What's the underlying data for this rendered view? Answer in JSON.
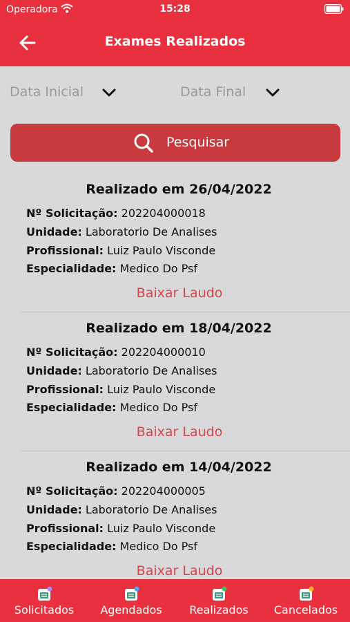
{
  "status": {
    "carrier": "Operadora",
    "time": "15:28"
  },
  "header": {
    "title": "Exames Realizados"
  },
  "filters": {
    "start_label": "Data Inicial",
    "end_label": "Data Final"
  },
  "search": {
    "label": "Pesquisar"
  },
  "exams": [
    {
      "date": "Realizado em 26/04/2022",
      "request": "202204000018",
      "unit": "Laboratorio De Analises",
      "professional": "Luiz Paulo Visconde",
      "specialty": "Medico Do Psf",
      "download": "Baixar Laudo"
    },
    {
      "date": "Realizado em 18/04/2022",
      "request": "202204000010",
      "unit": "Laboratorio De Analises",
      "professional": "Luiz Paulo Visconde",
      "specialty": "Medico Do Psf",
      "download": "Baixar Laudo"
    },
    {
      "date": "Realizado em 14/04/2022",
      "request": "202204000005",
      "unit": "Laboratorio De Analises",
      "professional": "Luiz Paulo Visconde",
      "specialty": "Medico Do Psf",
      "download": "Baixar Laudo"
    }
  ],
  "field_labels": {
    "request": "Nº Solicitação:",
    "unit": "Unidade:",
    "professional": "Profissional:",
    "specialty": "Especialidade:"
  },
  "tabs": [
    {
      "label": "Solicitados",
      "badge_color": "#a989ff"
    },
    {
      "label": "Agendados",
      "badge_color": "#4fa3ff"
    },
    {
      "label": "Realizados",
      "badge_color": "#3fbf5f"
    },
    {
      "label": "Cancelados",
      "badge_color": "#ffb020"
    }
  ],
  "colors": {
    "brand": "#e8303f",
    "button": "#c83a3e",
    "link": "#d2464a"
  }
}
